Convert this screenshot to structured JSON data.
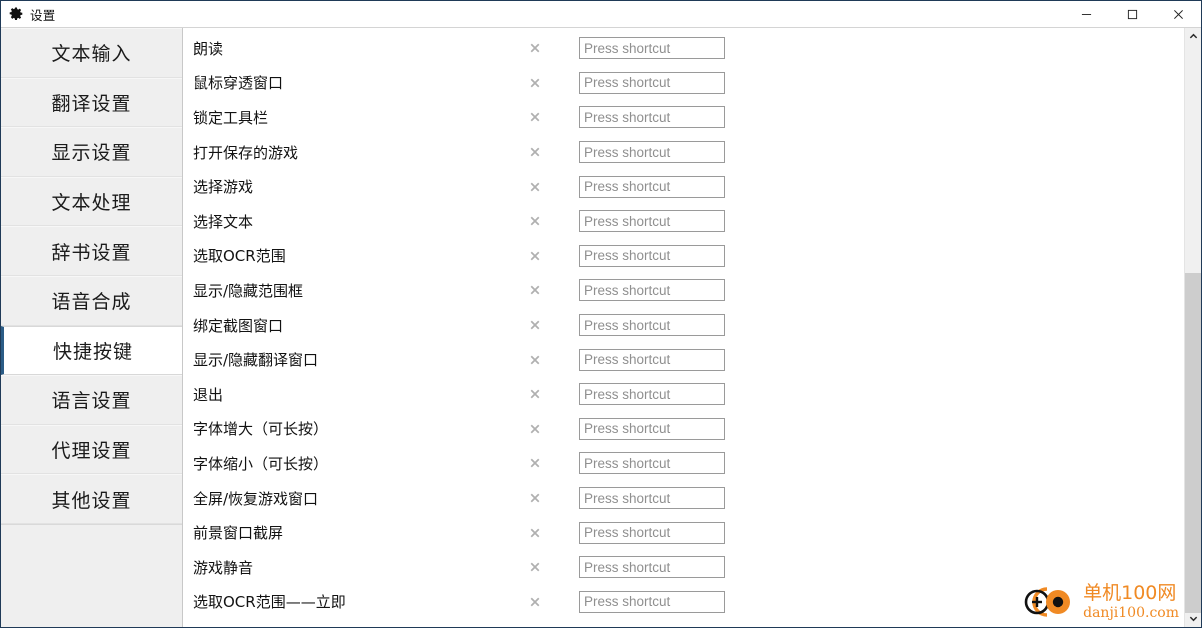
{
  "window": {
    "title": "设置",
    "app_icon": "gear-icon",
    "controls": {
      "minimize": "minimize-icon",
      "maximize": "maximize-icon",
      "close": "close-icon"
    }
  },
  "sidebar": {
    "items": [
      {
        "label": "文本输入",
        "selected": false
      },
      {
        "label": "翻译设置",
        "selected": false
      },
      {
        "label": "显示设置",
        "selected": false
      },
      {
        "label": "文本处理",
        "selected": false
      },
      {
        "label": "辞书设置",
        "selected": false
      },
      {
        "label": "语音合成",
        "selected": false
      },
      {
        "label": "快捷按键",
        "selected": true
      },
      {
        "label": "语言设置",
        "selected": false
      },
      {
        "label": "代理设置",
        "selected": false
      },
      {
        "label": "其他设置",
        "selected": false
      }
    ]
  },
  "main": {
    "clear_icon": "clear-x-icon",
    "shortcut_placeholder": "Press shortcut",
    "rows": [
      {
        "label": "朗读",
        "shortcut": ""
      },
      {
        "label": "鼠标穿透窗口",
        "shortcut": ""
      },
      {
        "label": "锁定工具栏",
        "shortcut": ""
      },
      {
        "label": "打开保存的游戏",
        "shortcut": ""
      },
      {
        "label": "选择游戏",
        "shortcut": ""
      },
      {
        "label": "选择文本",
        "shortcut": ""
      },
      {
        "label": "选取OCR范围",
        "shortcut": ""
      },
      {
        "label": "显示/隐藏范围框",
        "shortcut": ""
      },
      {
        "label": "绑定截图窗口",
        "shortcut": ""
      },
      {
        "label": "显示/隐藏翻译窗口",
        "shortcut": ""
      },
      {
        "label": "退出",
        "shortcut": ""
      },
      {
        "label": "字体增大（可长按）",
        "shortcut": ""
      },
      {
        "label": "字体缩小（可长按）",
        "shortcut": ""
      },
      {
        "label": "全屏/恢复游戏窗口",
        "shortcut": ""
      },
      {
        "label": "前景窗口截屏",
        "shortcut": ""
      },
      {
        "label": "游戏静音",
        "shortcut": ""
      },
      {
        "label": "选取OCR范围——立即",
        "shortcut": ""
      }
    ]
  },
  "scrollbar": {
    "up_arrow": "chevron-up-icon",
    "down_arrow": "chevron-down-icon"
  },
  "watermark": {
    "cn": "单机100网",
    "en": "danji100.com",
    "color": "#f08a24"
  }
}
